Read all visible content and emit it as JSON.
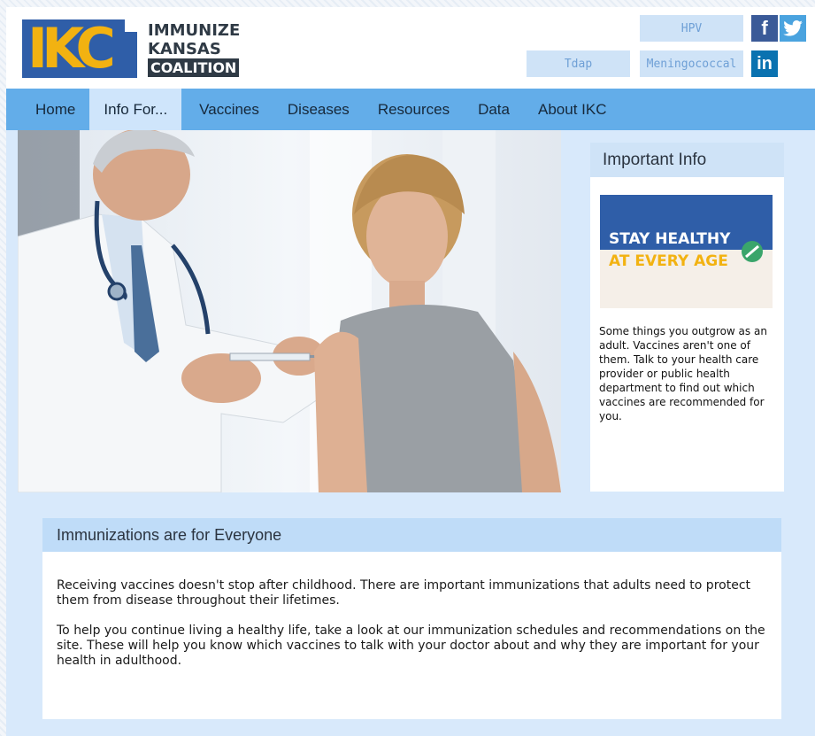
{
  "logo": {
    "mark": "IKC",
    "line1": "IMMUNIZE",
    "line2": "KANSAS",
    "line3": "COALITION"
  },
  "quick_links": {
    "hpv": "HPV",
    "tdap": "Tdap",
    "meningococcal": "Meningococcal"
  },
  "social": {
    "facebook": "f",
    "linkedin": "in"
  },
  "nav": {
    "items": [
      "Home",
      "Info For...",
      "Vaccines",
      "Diseases",
      "Resources",
      "Data",
      "About IKC"
    ],
    "active": "Info For..."
  },
  "sidebar": {
    "title": "Important Info",
    "promo_line1": "STAY HEALTHY",
    "promo_line2": "AT EVERY AGE",
    "text": "Some things you outgrow as an adult. Vaccines aren't one of them. Talk to your health care provider or public health department to find out which vaccines are recommended for you."
  },
  "panel": {
    "title": "Immunizations are for Everyone",
    "para1": "Receiving vaccines doesn't stop after childhood. There are important immunizations that adults need to protect them from disease throughout their lifetimes.",
    "para2": "To help you continue living a healthy life, take a look at our immunization schedules and recommendations on the site. These will help you know which vaccines to talk with your doctor about and why they are important for your health in adulthood."
  },
  "colors": {
    "nav": "#63ade9",
    "brand_blue": "#2f5ea8",
    "brand_gold": "#f2b211",
    "content_bg": "#d8e9fb"
  }
}
